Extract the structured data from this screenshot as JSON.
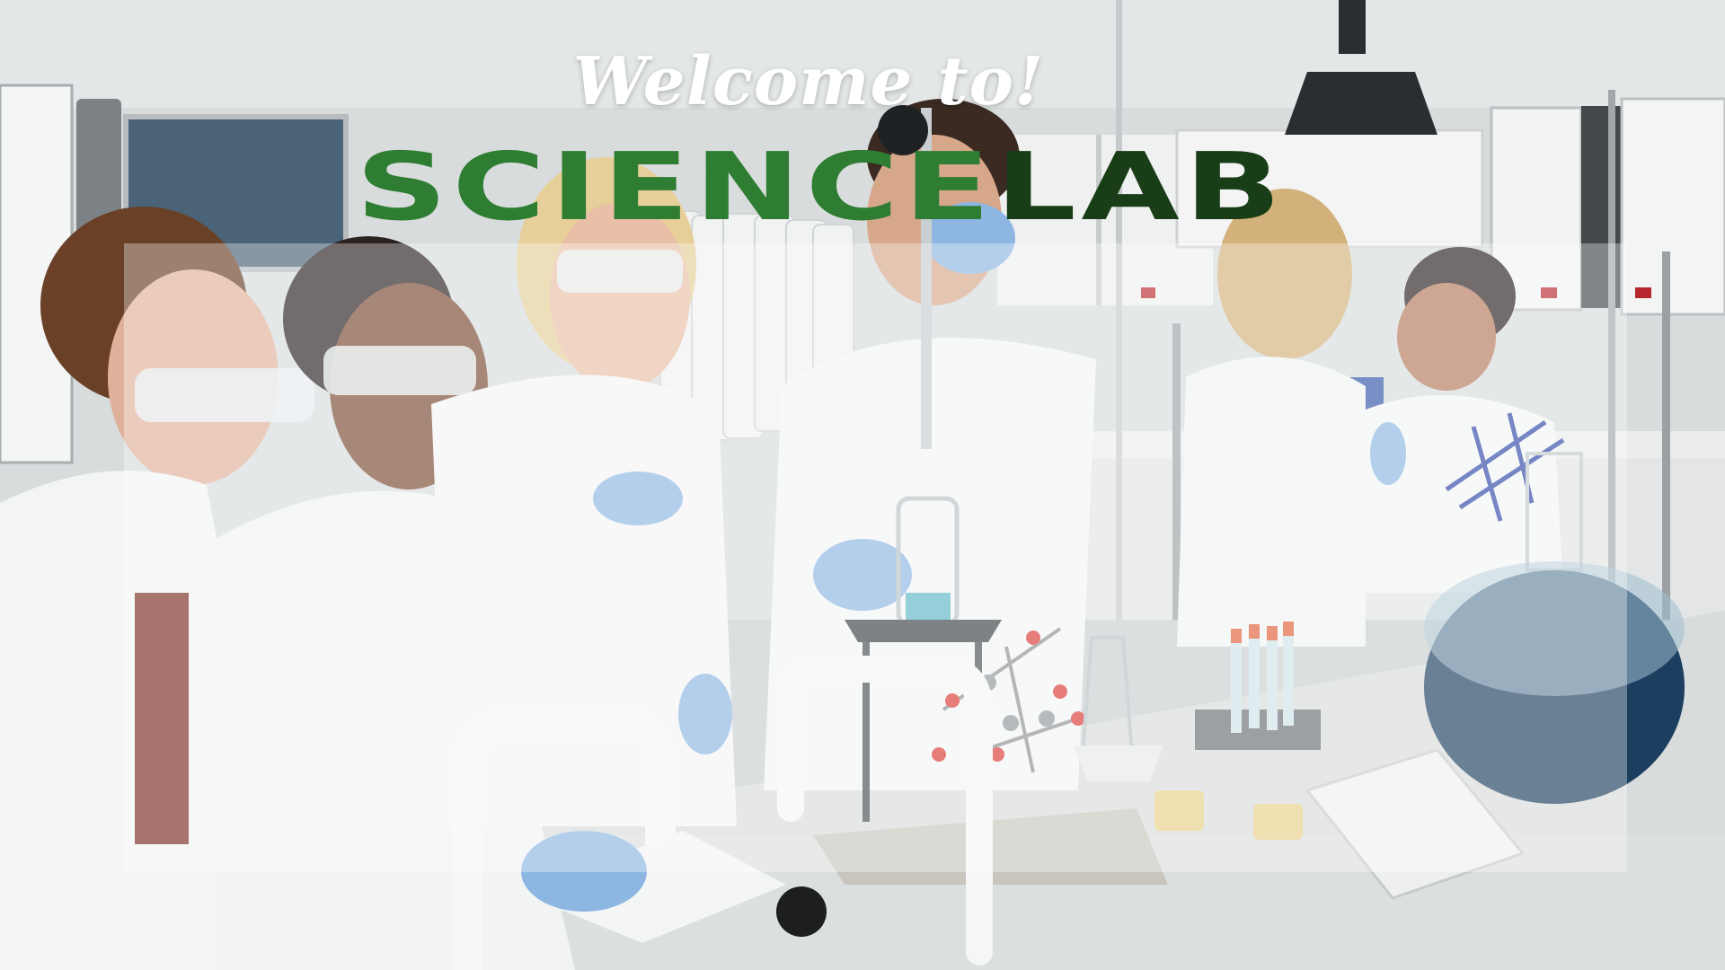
{
  "hero": {
    "welcome_text": "Welcome to!",
    "title_part_1": "SCIENCE",
    "title_part_2": "LAB"
  },
  "colors": {
    "title_primary": "#2e7d32",
    "title_secondary": "#183d17",
    "welcome": "#ffffff",
    "overlay": "rgba(255,255,255,0.34)"
  },
  "background": {
    "image": "lab-scene-photo"
  }
}
